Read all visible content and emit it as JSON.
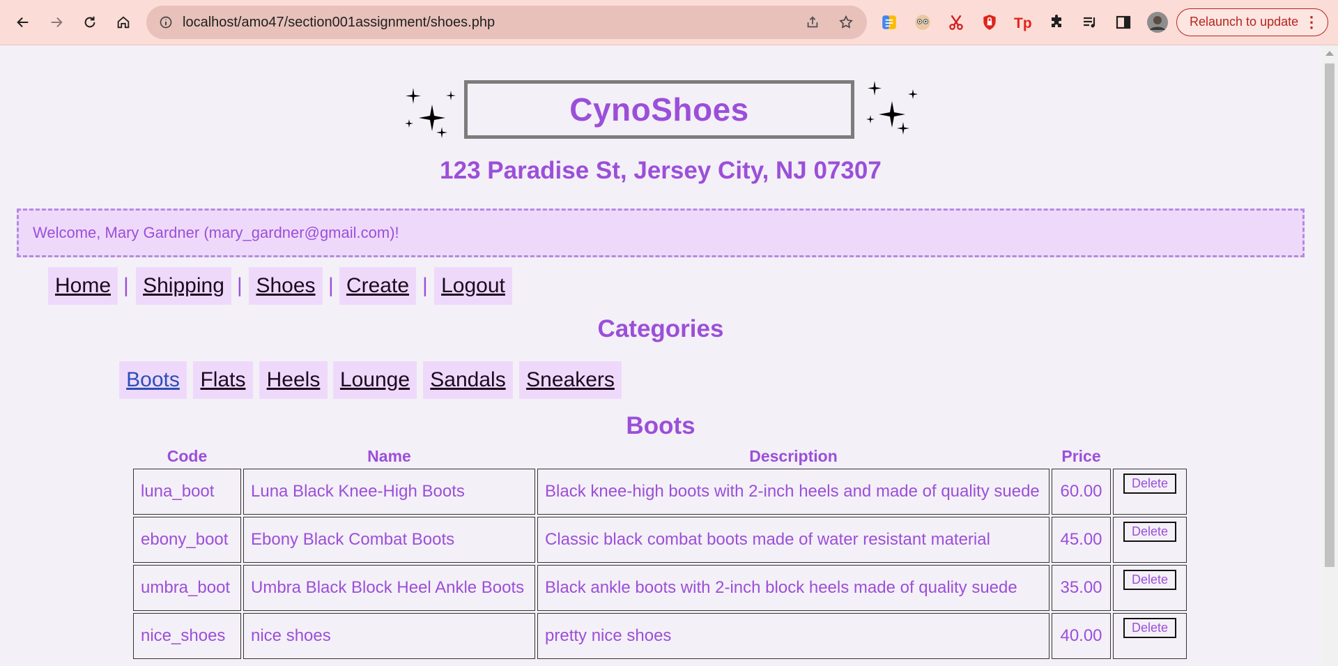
{
  "browser": {
    "url": "localhost/amo47/section001assignment/shoes.php",
    "relaunch_label": "Relaunch to update"
  },
  "header": {
    "title": "CynoShoes",
    "address": "123 Paradise St, Jersey City, NJ 07307"
  },
  "welcome": "Welcome, Mary Gardner (mary_gardner@gmail.com)!",
  "nav": {
    "items": [
      "Home",
      "Shipping",
      "Shoes",
      "Create",
      "Logout"
    ],
    "separator": "|"
  },
  "categories": {
    "heading": "Categories",
    "items": [
      "Boots",
      "Flats",
      "Heels",
      "Lounge",
      "Sandals",
      "Sneakers"
    ],
    "active": "Boots"
  },
  "section_title": "Boots",
  "table": {
    "headers": [
      "Code",
      "Name",
      "Description",
      "Price"
    ],
    "delete_label": "Delete",
    "rows": [
      {
        "code": "luna_boot",
        "name": "Luna Black Knee-High Boots",
        "description": "Black knee-high boots with 2-inch heels and made of quality suede",
        "price": "60.00"
      },
      {
        "code": "ebony_boot",
        "name": "Ebony Black Combat Boots",
        "description": "Classic black combat boots made of water resistant material",
        "price": "45.00"
      },
      {
        "code": "umbra_boot",
        "name": "Umbra Black Block Heel Ankle Boots",
        "description": "Black ankle boots with 2-inch block heels made of quality suede",
        "price": "35.00"
      },
      {
        "code": "nice_shoes",
        "name": "nice shoes",
        "description": "pretty nice shoes",
        "price": "40.00"
      }
    ]
  },
  "colors": {
    "accent": "#9b4fd9",
    "highlight_bg": "#efd9fb",
    "page_bg": "#f4f0f7",
    "chrome_bg": "#fcdcd6"
  }
}
